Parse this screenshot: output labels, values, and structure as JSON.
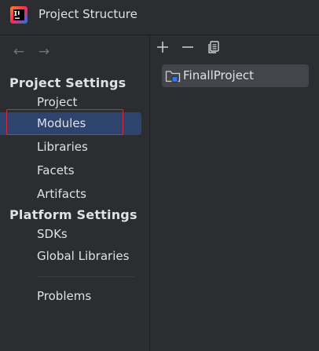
{
  "window": {
    "title": "Project Structure",
    "app_icon": "intellij-idea-icon"
  },
  "navigation": {
    "back_icon": "arrow-left-icon",
    "forward_icon": "arrow-right-icon"
  },
  "sidebar": {
    "project_settings_header": "Project Settings",
    "project_settings_items": [
      {
        "label": "Project"
      },
      {
        "label": "Modules",
        "selected": true
      },
      {
        "label": "Libraries"
      },
      {
        "label": "Facets"
      },
      {
        "label": "Artifacts"
      }
    ],
    "platform_settings_header": "Platform Settings",
    "platform_settings_items": [
      {
        "label": "SDKs"
      },
      {
        "label": "Global Libraries"
      }
    ],
    "other_items": [
      {
        "label": "Problems"
      }
    ]
  },
  "toolbar": {
    "add_icon": "plus-icon",
    "remove_icon": "minus-icon",
    "copy_icon": "copy-icon"
  },
  "modules": {
    "items": [
      {
        "label": "FinallProject",
        "icon": "module-folder-icon"
      }
    ]
  },
  "colors": {
    "background": "#2b2d30",
    "selection": "#2e436e",
    "item_highlight": "#43454a",
    "annotation_box": "#d12b37",
    "module_badge": "#3574f0"
  }
}
